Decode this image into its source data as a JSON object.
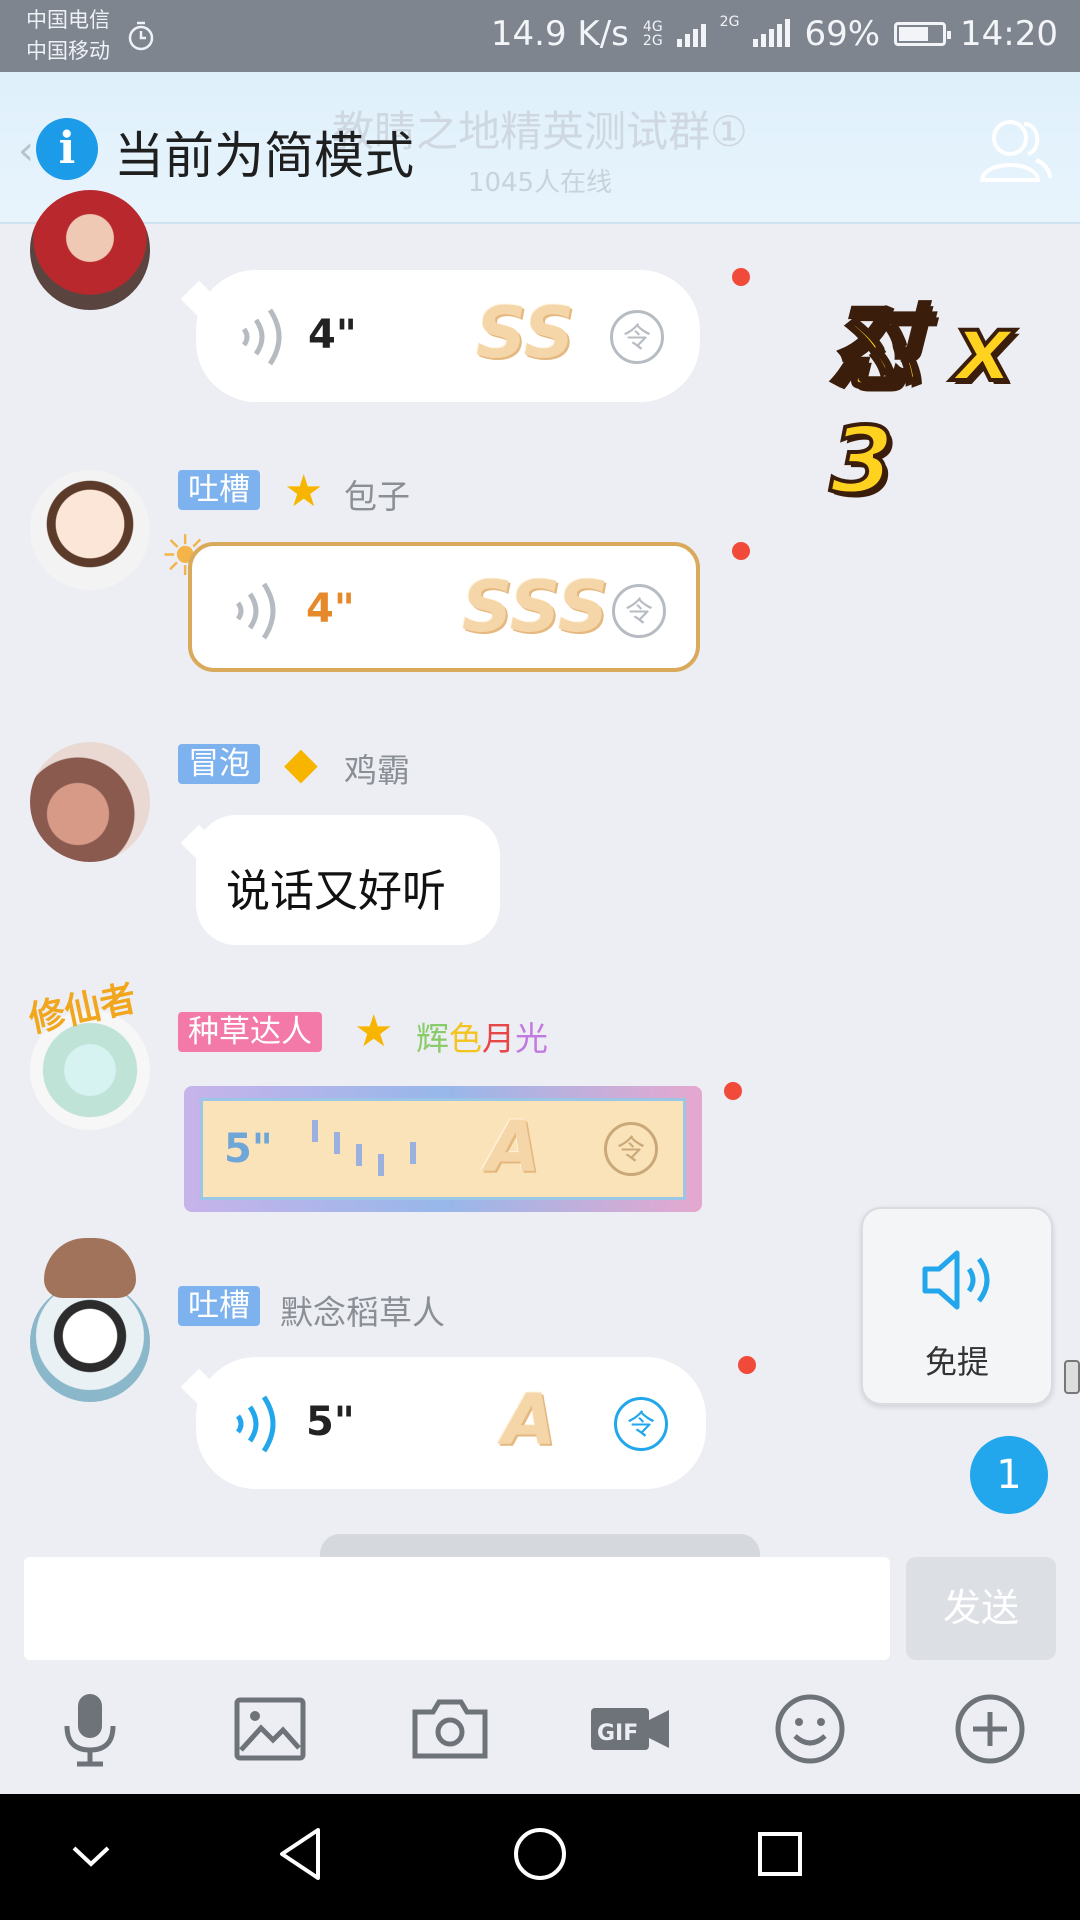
{
  "status_bar": {
    "carrier1": "中国电信",
    "carrier2": "中国移动",
    "speed": "14.9 K/s",
    "net1": "4G",
    "net2": "2G",
    "net3": "2G",
    "battery": "69%",
    "battery_level": 0.69,
    "time": "14:20"
  },
  "header": {
    "title": "教睛之地精英测试群①",
    "subtitle": "1045人在线",
    "toast": "当前为简模式",
    "toast_ghost": "简模式"
  },
  "messages": [
    {
      "duration": "4\"",
      "rank": "SS"
    },
    {
      "tag": "吐槽",
      "name": "包子",
      "duration": "4\"",
      "rank": "SSS"
    },
    {
      "tag": "冒泡",
      "name": "鸡霸",
      "text": "说话又好听"
    },
    {
      "tag": "种草达人",
      "name_parts": [
        "辉",
        "色",
        "月",
        "光"
      ],
      "duration": "5\"",
      "rank": "A",
      "avatar_text": "修仙者"
    },
    {
      "tag": "吐槽",
      "name": "默念稻草人",
      "duration": "5\"",
      "rank": "A"
    }
  ],
  "ling_glyph": "令",
  "combo": "怼 x 3",
  "mute": {
    "label": "免提"
  },
  "unread_count": "1",
  "input": {
    "send_label": "发送"
  },
  "colors": {
    "accent": "#22a6ec",
    "tag_blue": "#7db2ee",
    "tag_pink": "#f279a8",
    "red_dot": "#f24a3a"
  }
}
